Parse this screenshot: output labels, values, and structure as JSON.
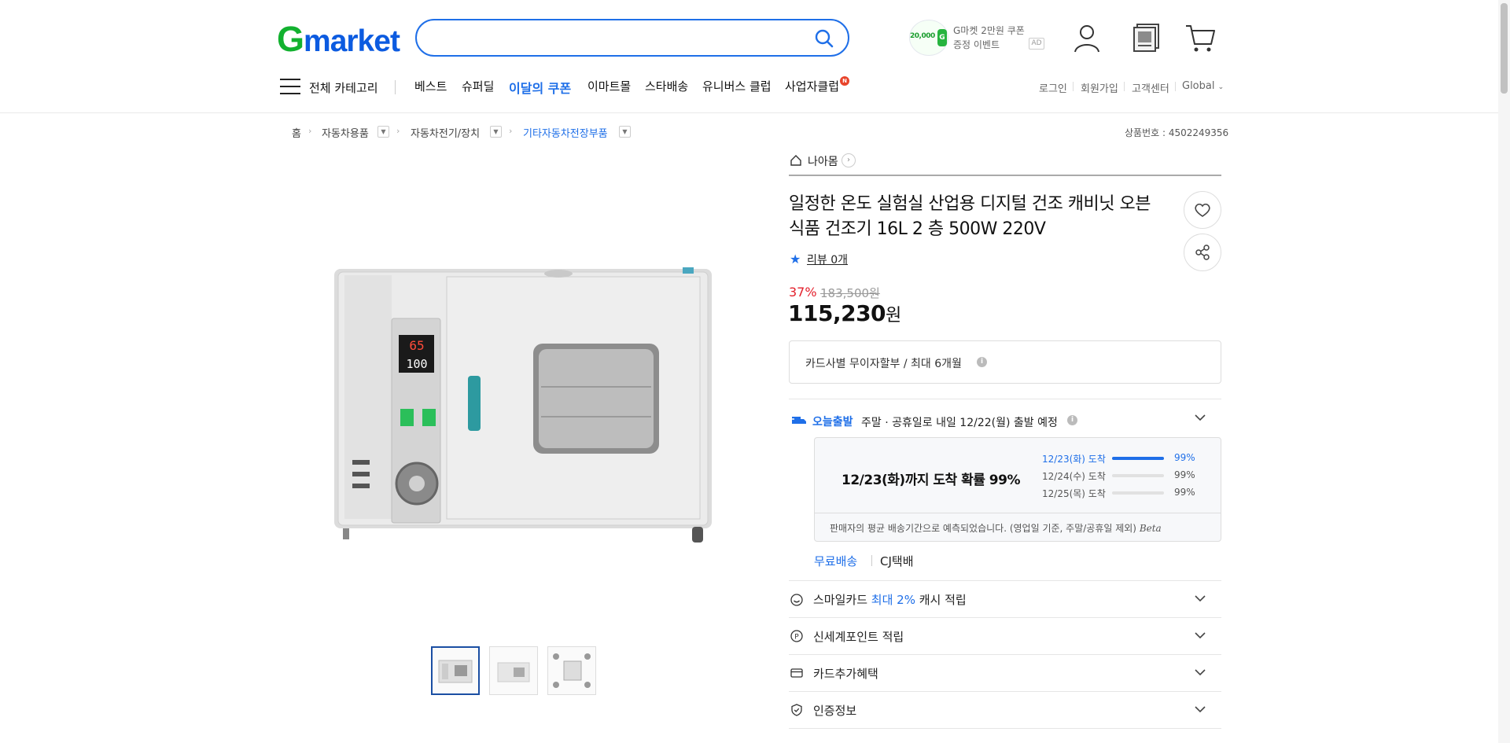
{
  "header": {
    "logo_g": "G",
    "logo_rest": "market",
    "search": {
      "placeholder": "",
      "value": ""
    },
    "promo": {
      "amount": "20,000",
      "won_symbol": "G",
      "line1": "G마켓 2만원 쿠폰",
      "line2": "증정 이벤트",
      "ad": "AD"
    }
  },
  "nav": {
    "all_categories": "전체 카테고리",
    "items": [
      "베스트",
      "슈퍼딜",
      "이달의 쿠폰",
      "이마트몰",
      "스타배송",
      "유니버스 클럽",
      "사업자클럽"
    ],
    "new_badge": "N",
    "utils": [
      "로그인",
      "회원가입",
      "고객센터",
      "Global"
    ]
  },
  "breadcrumb": {
    "home": "홈",
    "levels": [
      "자동차용품",
      "자동차전기/장치",
      "기타자동차전장부품"
    ],
    "product_no": "상품번호 : 4502249356"
  },
  "product": {
    "store": "나아몸",
    "title": "일정한 온도 실험실 산업용 디지털 건조 캐비닛 오븐 식품 건조기 16L 2 층 500W 220V",
    "review": "리뷰 0개",
    "discount": "37%",
    "original_price": "183,500원",
    "price": "115,230",
    "price_unit": "원",
    "installment": "카드사별 무이자할부 / 최대 6개월",
    "panel_display": {
      "temp_set": "65",
      "temp_now": "100"
    }
  },
  "shipping": {
    "badge": "오늘출발",
    "text": "주말 · 공휴일로 내일 12/22(월) 출발 예정",
    "probability_main": "12/23(화)까지 도착 확률 99%",
    "rows": [
      {
        "date": "12/23(화) 도착",
        "pct": "99%",
        "fill": 1.0
      },
      {
        "date": "12/24(수) 도착",
        "pct": "99%",
        "fill": 0.0
      },
      {
        "date": "12/25(목) 도착",
        "pct": "99%",
        "fill": 0.0
      }
    ],
    "estimate_note": "판매자의 평균 배송기간으로 예측되었습니다. (영업일 기준, 주말/공휴일 제외)",
    "beta": "Beta",
    "free": "무료배송",
    "carrier": "CJ택배"
  },
  "benefits": {
    "smile_prefix": "스마일카드",
    "smile_highlight": "최대 2%",
    "smile_suffix": "캐시 적립",
    "shinsegae": "신세계포인트 적립",
    "card_extra": "카드추가혜택",
    "certification": "인증정보"
  },
  "colors": {
    "accent": "#1f6fe8",
    "logo_green": "#12b12f",
    "discount_red": "#e3202c"
  }
}
